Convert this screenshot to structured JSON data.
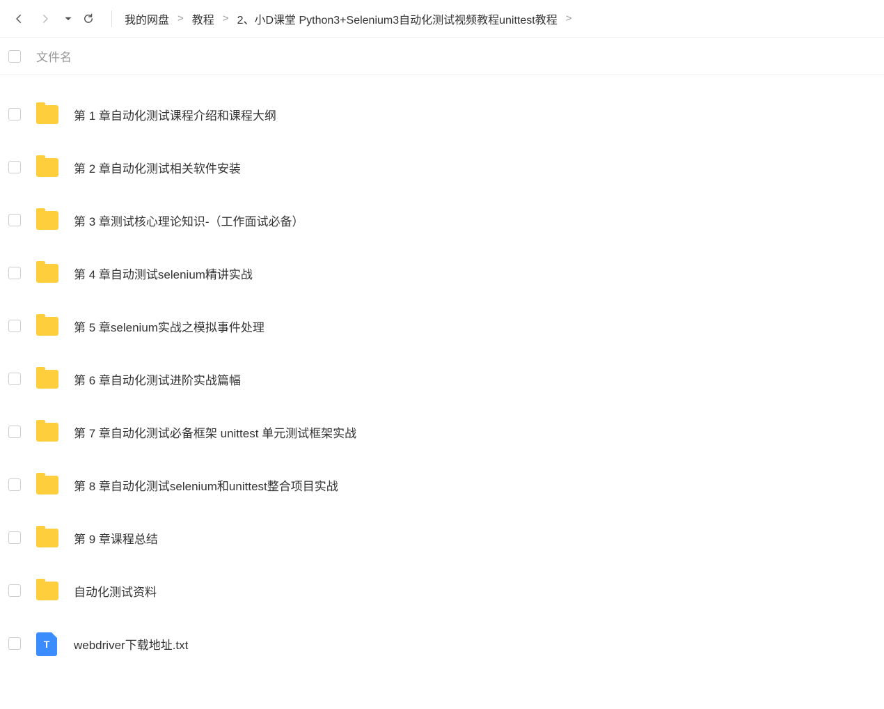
{
  "toolbar": {
    "breadcrumb": [
      "我的网盘",
      "教程",
      "2、小D课堂 Python3+Selenium3自动化测试视频教程unittest教程"
    ]
  },
  "header": {
    "col_name": "文件名"
  },
  "files": [
    {
      "type": "folder",
      "name": "第 1 章自动化测试课程介绍和课程大纲"
    },
    {
      "type": "folder",
      "name": "第 2 章自动化测试相关软件安装"
    },
    {
      "type": "folder",
      "name": "第 3 章测试核心理论知识-（工作面试必备）"
    },
    {
      "type": "folder",
      "name": "第 4 章自动测试selenium精讲实战"
    },
    {
      "type": "folder",
      "name": "第 5 章selenium实战之模拟事件处理"
    },
    {
      "type": "folder",
      "name": "第 6 章自动化测试进阶实战篇幅"
    },
    {
      "type": "folder",
      "name": "第 7 章自动化测试必备框架 unittest 单元测试框架实战"
    },
    {
      "type": "folder",
      "name": "第 8 章自动化测试selenium和unittest整合项目实战"
    },
    {
      "type": "folder",
      "name": "第 9 章课程总结"
    },
    {
      "type": "folder",
      "name": "自动化测试资料"
    },
    {
      "type": "txt",
      "name": "webdriver下载地址.txt"
    }
  ],
  "icons": {
    "txt_letter": "T"
  }
}
